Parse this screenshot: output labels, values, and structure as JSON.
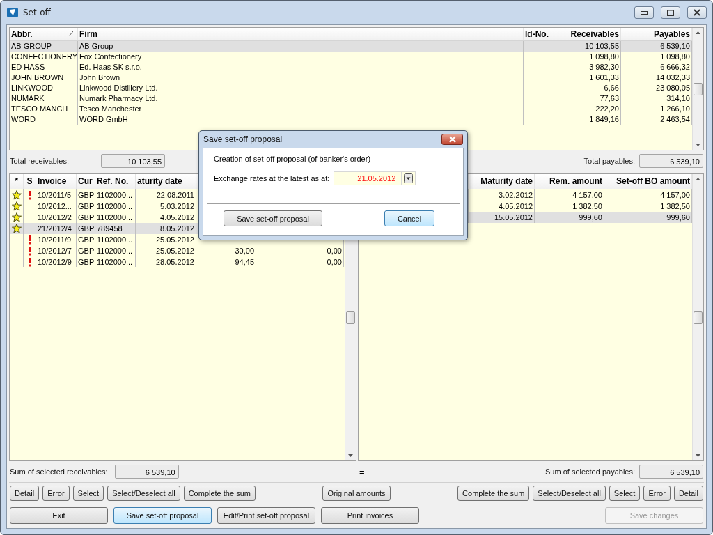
{
  "window": {
    "title": "Set-off"
  },
  "firms_grid": {
    "columns": [
      {
        "label": "Abbr.",
        "sorted": true
      },
      {
        "label": "Firm",
        "sorted": false
      },
      {
        "label": "Id-No.",
        "sorted": false
      },
      {
        "label": "Receivables",
        "sorted": false
      },
      {
        "label": "Payables",
        "sorted": false
      }
    ],
    "rows": [
      {
        "abbr": "AB GROUP",
        "firm": "AB Group",
        "receivables": "10 103,55",
        "payables": "6 539,10",
        "selected": true
      },
      {
        "abbr": "CONFECTIONERY",
        "firm": "Fox Confectionery",
        "receivables": "1 098,80",
        "payables": "1 098,80",
        "selected": false
      },
      {
        "abbr": "ED HASS",
        "firm": "Ed. Haas SK s.r.o.",
        "receivables": "3 982,30",
        "payables": "6 666,32",
        "selected": false
      },
      {
        "abbr": "JOHN BROWN",
        "firm": "John Brown",
        "receivables": "1 601,33",
        "payables": "14 032,33",
        "selected": false
      },
      {
        "abbr": "LINKWOOD",
        "firm": "Linkwood Distillery Ltd.",
        "receivables": "6,66",
        "payables": "23 080,05",
        "selected": false
      },
      {
        "abbr": "NUMARK",
        "firm": "Numark Pharmacy Ltd.",
        "receivables": "77,63",
        "payables": "314,10",
        "selected": false
      },
      {
        "abbr": "TESCO MANCH",
        "firm": "Tesco Manchester",
        "receivables": "222,20",
        "payables": "1 266,10",
        "selected": false
      },
      {
        "abbr": "WORD",
        "firm": "WORD GmbH",
        "receivables": "1 849,16",
        "payables": "2 463,54",
        "selected": false
      }
    ]
  },
  "totals": {
    "receivables_label": "Total receivables:",
    "receivables_value": "10 103,55",
    "payables_label": "Total payables:",
    "payables_value": "6 539,10"
  },
  "receivables_grid": {
    "columns": [
      "*",
      "S",
      "Invoice",
      "Cur",
      "Ref. No.",
      "aturity date"
    ],
    "rows": [
      {
        "starred": true,
        "warning": true,
        "invoice": "10/2011/5",
        "currency": "GBP",
        "ref_no": "1102000...",
        "maturity_date": "22.08.2011",
        "selected": false
      },
      {
        "starred": true,
        "warning": false,
        "invoice": "10/2012...",
        "currency": "GBP",
        "ref_no": "1102000...",
        "maturity_date": "5.03.2012",
        "selected": false
      },
      {
        "starred": true,
        "warning": false,
        "invoice": "10/2012/2",
        "currency": "GBP",
        "ref_no": "1102000...",
        "maturity_date": "4.05.2012",
        "selected": false
      },
      {
        "starred": true,
        "warning": false,
        "invoice": "21/2012/4",
        "currency": "GBP",
        "ref_no": "789458",
        "maturity_date": "8.05.2012",
        "selected": true
      },
      {
        "starred": false,
        "warning": true,
        "invoice": "10/2011/9",
        "currency": "GBP",
        "ref_no": "1102000...",
        "maturity_date": "25.05.2012",
        "selected": false
      },
      {
        "starred": false,
        "warning": true,
        "invoice": "10/2012/7",
        "currency": "GBP",
        "ref_no": "1102000...",
        "maturity_date": "25.05.2012",
        "column_7": "30,00",
        "column_8": "0,00",
        "selected": false
      },
      {
        "starred": false,
        "warning": true,
        "invoice": "10/2012/9",
        "currency": "GBP",
        "ref_no": "1102000...",
        "maturity_date": "28.05.2012",
        "column_7": "94,45",
        "column_8": "0,00",
        "selected": false
      }
    ]
  },
  "payables_grid": {
    "columns": [
      "Maturity date",
      "Rem. amount",
      "Set-off BO amount"
    ],
    "rows": [
      {
        "maturity_date": "3.02.2012",
        "rem_amount": "4 157,00",
        "setoff_amount": "4 157,00",
        "selected": false
      },
      {
        "maturity_date": "4.05.2012",
        "rem_amount": "1 382,50",
        "setoff_amount": "1 382,50",
        "selected": false
      },
      {
        "maturity_date": "15.05.2012",
        "rem_amount": "999,60",
        "setoff_amount": "999,60",
        "selected": true
      }
    ]
  },
  "sums": {
    "receivables_label": "Sum of selected receivables:",
    "receivables_value": "6 539,10",
    "equals": "=",
    "payables_label": "Sum of selected payables:",
    "payables_value": "6 539,10"
  },
  "left_buttons": [
    "Detail",
    "Error",
    "Select",
    "Select/Deselect all",
    "Complete the sum"
  ],
  "middle_button": "Original amounts",
  "right_buttons": [
    "Complete the sum",
    "Select/Deselect all",
    "Select",
    "Error",
    "Detail"
  ],
  "bottom_buttons": [
    {
      "label": "Exit",
      "focused": false,
      "disabled": false
    },
    {
      "label": "Save set-off proposal",
      "focused": true,
      "disabled": false
    },
    {
      "label": "Edit/Print set-off proposal",
      "focused": false,
      "disabled": false
    },
    {
      "label": "Print invoices",
      "focused": false,
      "disabled": false
    }
  ],
  "save_button": {
    "label": "Save changes",
    "disabled": true
  },
  "dialog": {
    "title": "Save set-off proposal",
    "text": "Creation of set-off proposal (of banker's order)",
    "field_label": "Exchange rates at the latest as at:",
    "date_value": "21.05.2012",
    "buttons": [
      {
        "label": "Save set-off proposal",
        "focused": false
      },
      {
        "label": "Cancel",
        "focused": true
      }
    ]
  }
}
